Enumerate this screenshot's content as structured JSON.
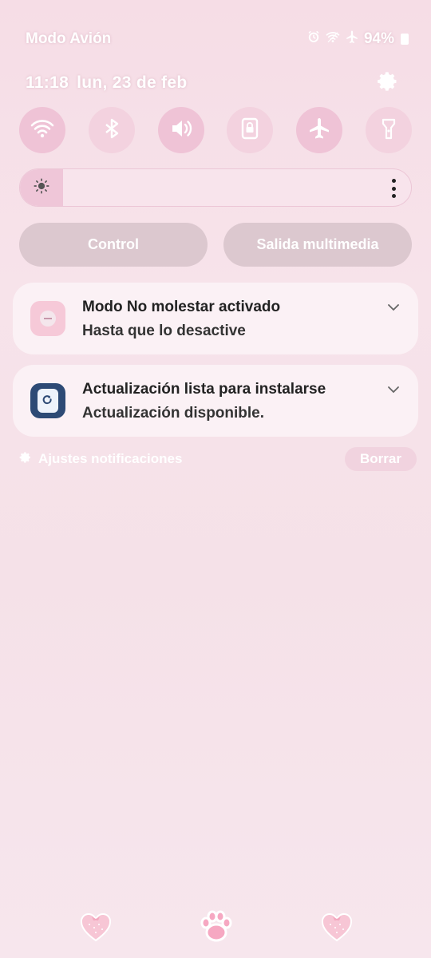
{
  "status_bar": {
    "mode_label": "Modo Avión",
    "battery": "94%",
    "icons": [
      "alarm-icon",
      "wifi-icon",
      "airplane-icon",
      "battery-icon"
    ]
  },
  "header": {
    "time": "11:18",
    "date": "lun, 23 de feb",
    "settings_icon": "gear-icon"
  },
  "quick_toggles": [
    {
      "name": "wifi",
      "icon": "wifi-icon",
      "state": "on"
    },
    {
      "name": "bluetooth",
      "icon": "bluetooth-icon",
      "state": "off"
    },
    {
      "name": "sound",
      "icon": "volume-icon",
      "state": "on"
    },
    {
      "name": "screen-lock",
      "icon": "lock-rotation-icon",
      "state": "off"
    },
    {
      "name": "airplane",
      "icon": "airplane-icon",
      "state": "on"
    },
    {
      "name": "flashlight",
      "icon": "flashlight-icon",
      "state": "off"
    }
  ],
  "brightness": {
    "level_fraction": 0.11,
    "icon": "sun-icon"
  },
  "buttons": {
    "control": "Control",
    "media_output": "Salida multimedia"
  },
  "notifications": [
    {
      "icon": "do-not-disturb-icon",
      "title": "Modo No molestar activado",
      "subtitle": "Hasta que lo desactive"
    },
    {
      "icon": "software-update-icon",
      "title": "Actualización lista para instalarse",
      "subtitle": "Actualización disponible."
    }
  ],
  "footer": {
    "notif_settings": "Ajustes notificaciones",
    "clear": "Borrar"
  },
  "dock": [
    "heart-icon",
    "paw-icon",
    "heart-icon"
  ],
  "colors": {
    "accent_pink": "#efc3d6",
    "update_icon_blue": "#2d4a75",
    "card_bg": "#fbf1f5"
  }
}
